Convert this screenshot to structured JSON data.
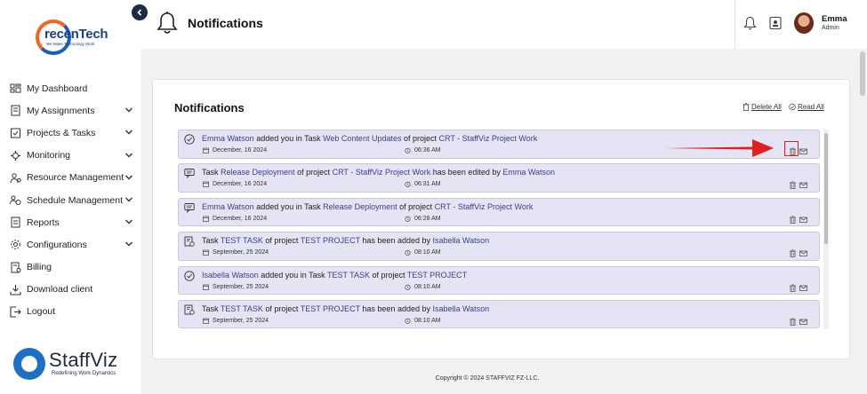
{
  "brand": {
    "logo_main": "recenTech",
    "logo_tagline": "We Make Technology Work",
    "footer_logo": "StaffViz",
    "footer_tagline": "Redefining Work Dynamics"
  },
  "sidebar": {
    "items": [
      {
        "label": "My Dashboard",
        "icon": "dashboard-icon",
        "chevron": false
      },
      {
        "label": "My Assignments",
        "icon": "assignments-icon",
        "chevron": true
      },
      {
        "label": "Projects & Tasks",
        "icon": "projects-icon",
        "chevron": true
      },
      {
        "label": "Monitoring",
        "icon": "monitoring-icon",
        "chevron": true
      },
      {
        "label": "Resource Management",
        "icon": "resource-icon",
        "chevron": true
      },
      {
        "label": "Schedule Management",
        "icon": "schedule-icon",
        "chevron": true
      },
      {
        "label": "Reports",
        "icon": "reports-icon",
        "chevron": true
      },
      {
        "label": "Configurations",
        "icon": "config-icon",
        "chevron": true
      },
      {
        "label": "Billing",
        "icon": "billing-icon",
        "chevron": false
      },
      {
        "label": "Download client",
        "icon": "download-icon",
        "chevron": false
      },
      {
        "label": "Logout",
        "icon": "logout-icon",
        "chevron": false
      }
    ]
  },
  "header": {
    "title": "Notifications",
    "user_name": "Emma",
    "user_role": "Admin"
  },
  "card": {
    "title": "Notifications",
    "delete_all": "Delete All",
    "read_all": "Read All"
  },
  "notifications": [
    {
      "icon": "check-circle-icon",
      "parts": [
        [
          "Emma Watson",
          "hl"
        ],
        [
          "  added you in Task ",
          ""
        ],
        [
          "Web Content Updates",
          "hl"
        ],
        [
          "  of project ",
          ""
        ],
        [
          "CRT - StaffViz Project Work",
          "hl"
        ]
      ],
      "date": "December, 16 2024",
      "time": "06:36 AM"
    },
    {
      "icon": "message-icon",
      "parts": [
        [
          "Task ",
          ""
        ],
        [
          "Release Deployment",
          "hl"
        ],
        [
          "  of project ",
          ""
        ],
        [
          "CRT - StaffViz Project Work",
          "hl"
        ],
        [
          "  has been edited by ",
          ""
        ],
        [
          "Emma Watson",
          "hl"
        ]
      ],
      "date": "December, 16 2024",
      "time": "06:31 AM"
    },
    {
      "icon": "message-icon",
      "parts": [
        [
          "Emma Watson",
          "hl"
        ],
        [
          "  added you in Task ",
          ""
        ],
        [
          "Release Deployment",
          "hl"
        ],
        [
          "  of project ",
          ""
        ],
        [
          "CRT - StaffViz Project Work",
          "hl"
        ]
      ],
      "date": "December, 16 2024",
      "time": "06:28 AM"
    },
    {
      "icon": "task-added-icon",
      "parts": [
        [
          "Task ",
          ""
        ],
        [
          "TEST TASK",
          "hl"
        ],
        [
          "  of project ",
          ""
        ],
        [
          "TEST PROJECT",
          "hl"
        ],
        [
          "  has been added by ",
          ""
        ],
        [
          "Isabella Watson",
          "hl"
        ]
      ],
      "date": "September, 25 2024",
      "time": "08:10 AM"
    },
    {
      "icon": "check-circle-icon",
      "parts": [
        [
          "Isabella Watson",
          "hl"
        ],
        [
          "  added you in Task ",
          ""
        ],
        [
          "TEST TASK",
          "hl"
        ],
        [
          "  of project ",
          ""
        ],
        [
          "TEST PROJECT",
          "hl"
        ]
      ],
      "date": "September, 25 2024",
      "time": "08:10 AM"
    },
    {
      "icon": "task-added-icon",
      "parts": [
        [
          "Task ",
          ""
        ],
        [
          "TEST TASK",
          "hl"
        ],
        [
          "  of project ",
          ""
        ],
        [
          "TEST PROJECT",
          "hl"
        ],
        [
          "  has been added by ",
          ""
        ],
        [
          "Isabella Watson",
          "hl"
        ]
      ],
      "date": "September, 25 2024",
      "time": "08:10 AM"
    }
  ],
  "footer": {
    "copyright": "Copyright © 2024 STAFFVIZ FZ-LLC."
  },
  "colors": {
    "accent": "#3a3f8f",
    "row_bg": "#e4e4f4",
    "highlight": "#e02020"
  }
}
